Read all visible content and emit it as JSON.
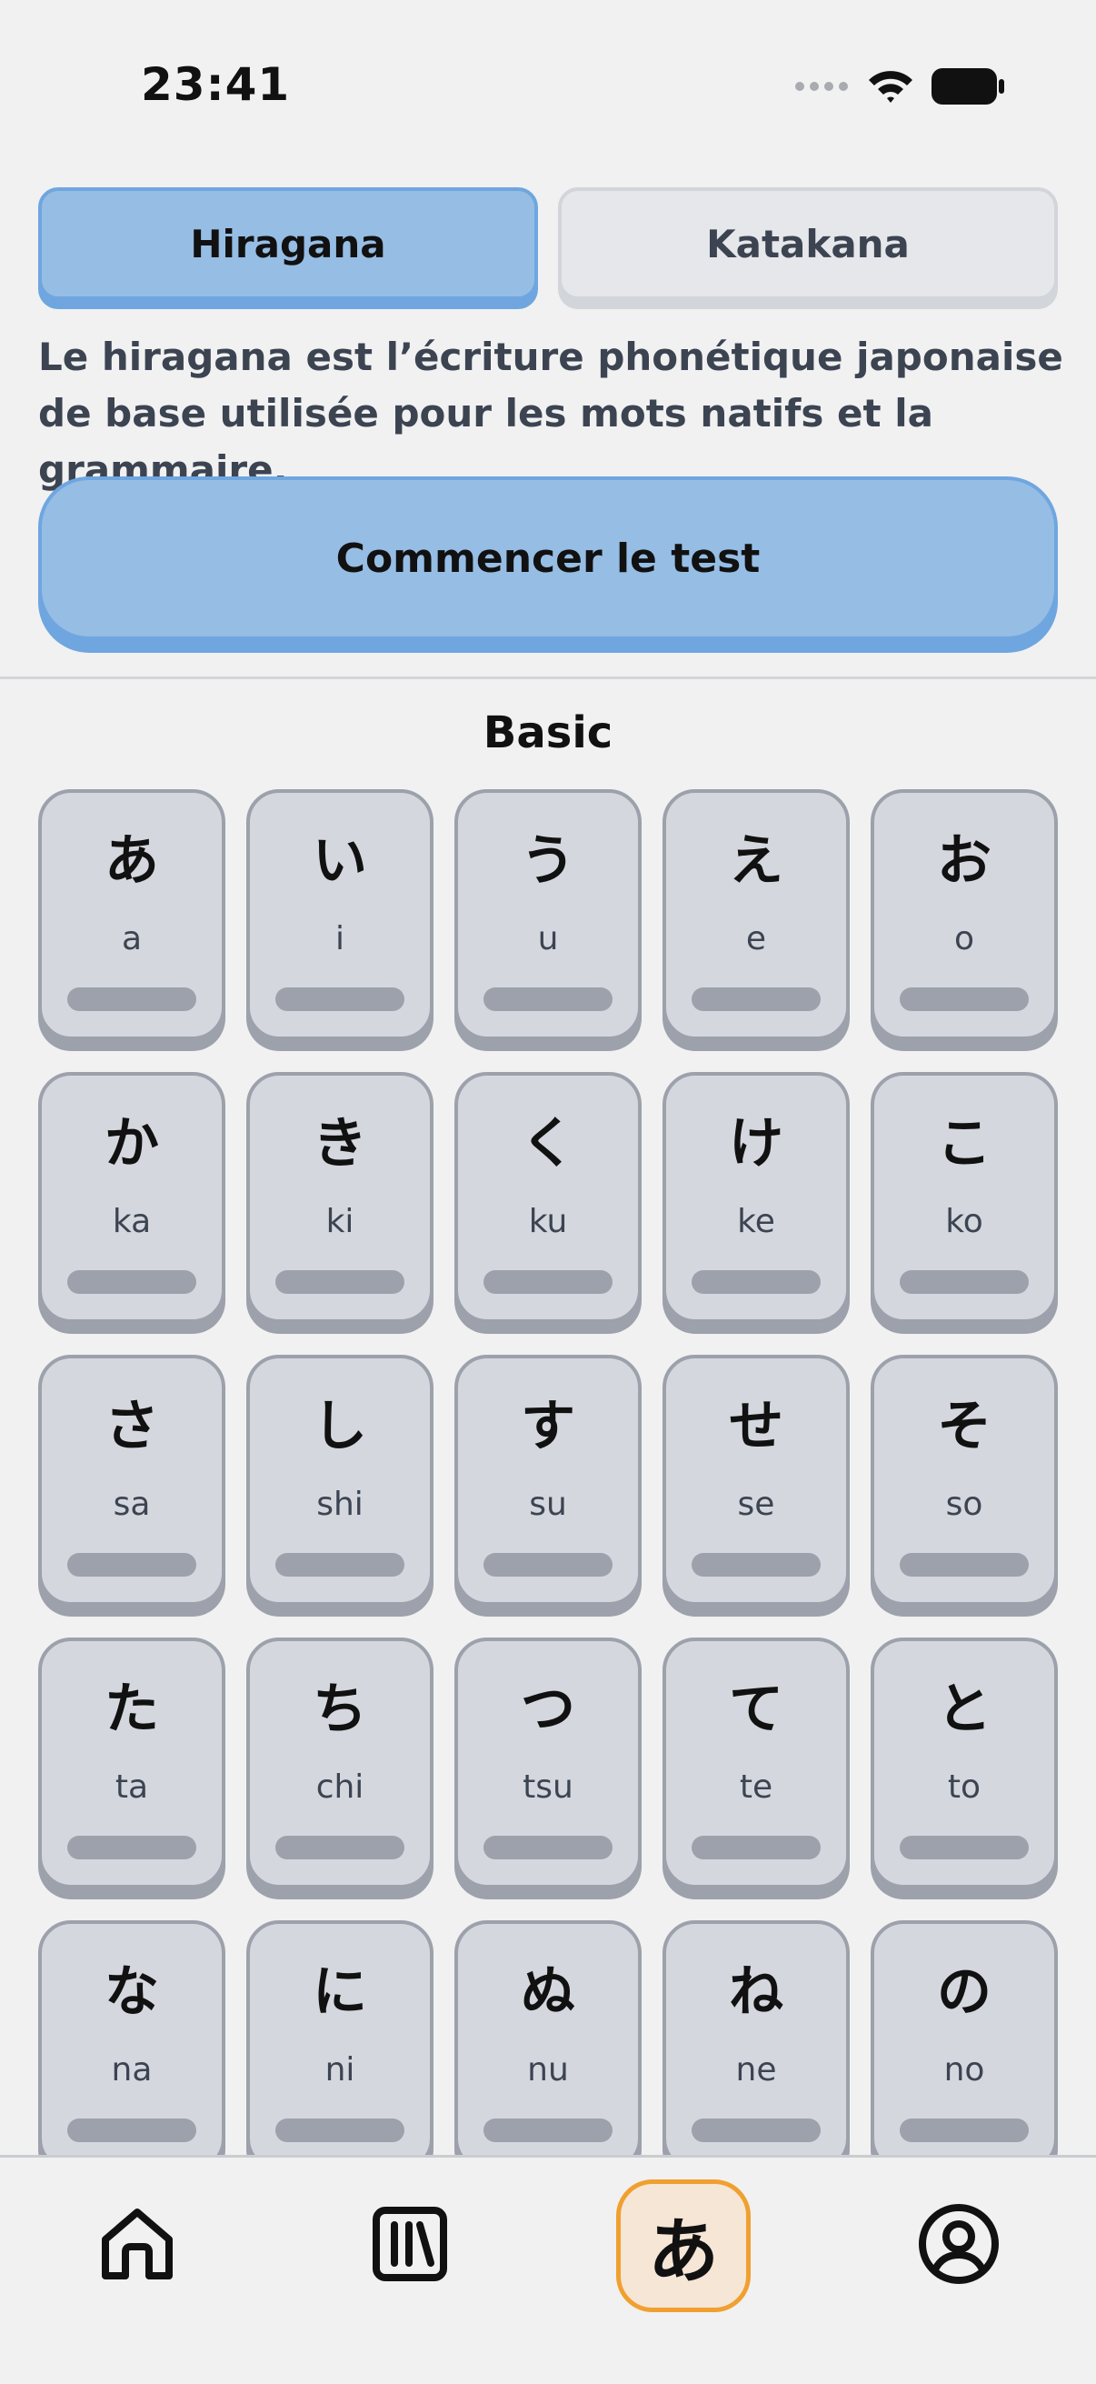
{
  "status_bar": {
    "time": "23:41"
  },
  "tabs": [
    {
      "label": "Hiragana",
      "active": true
    },
    {
      "label": "Katakana",
      "active": false
    }
  ],
  "description": "Le hiragana est l’écriture phonétique japonaise de base utilisée pour les mots natifs et la grammaire.",
  "start_button": {
    "label": "Commencer le test"
  },
  "section": {
    "title": "Basic"
  },
  "kana": [
    {
      "char": "あ",
      "romaji": "a"
    },
    {
      "char": "い",
      "romaji": "i"
    },
    {
      "char": "う",
      "romaji": "u"
    },
    {
      "char": "え",
      "romaji": "e"
    },
    {
      "char": "お",
      "romaji": "o"
    },
    {
      "char": "か",
      "romaji": "ka"
    },
    {
      "char": "き",
      "romaji": "ki"
    },
    {
      "char": "く",
      "romaji": "ku"
    },
    {
      "char": "け",
      "romaji": "ke"
    },
    {
      "char": "こ",
      "romaji": "ko"
    },
    {
      "char": "さ",
      "romaji": "sa"
    },
    {
      "char": "し",
      "romaji": "shi"
    },
    {
      "char": "す",
      "romaji": "su"
    },
    {
      "char": "せ",
      "romaji": "se"
    },
    {
      "char": "そ",
      "romaji": "so"
    },
    {
      "char": "た",
      "romaji": "ta"
    },
    {
      "char": "ち",
      "romaji": "chi"
    },
    {
      "char": "つ",
      "romaji": "tsu"
    },
    {
      "char": "て",
      "romaji": "te"
    },
    {
      "char": "と",
      "romaji": "to"
    },
    {
      "char": "な",
      "romaji": "na"
    },
    {
      "char": "に",
      "romaji": "ni"
    },
    {
      "char": "ぬ",
      "romaji": "nu"
    },
    {
      "char": "ね",
      "romaji": "ne"
    },
    {
      "char": "の",
      "romaji": "no"
    }
  ],
  "bottom_nav": {
    "items": [
      {
        "icon": "home-icon"
      },
      {
        "icon": "library-icon"
      },
      {
        "icon": "kana-icon",
        "label": "あ",
        "active": true
      },
      {
        "icon": "profile-icon"
      }
    ]
  },
  "colors": {
    "accent_blue": "#96bde4",
    "accent_blue_border": "#6fa6e0",
    "active_nav_border": "#f0a030",
    "active_nav_bg": "#f6e6d6",
    "card_bg": "#d4d7de",
    "card_border": "#9ca1ab"
  }
}
